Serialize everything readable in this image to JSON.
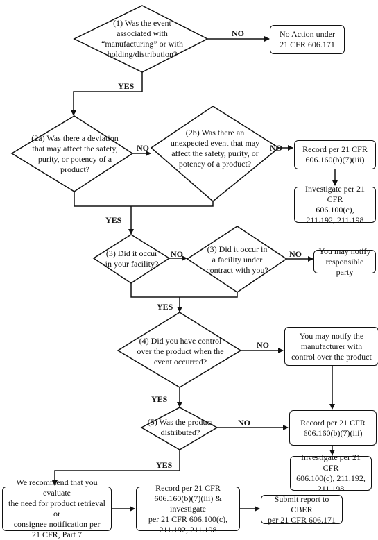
{
  "decisions": {
    "d1": "(1) Was the event\nassociated with\n“manufacturing” or with\nholding/distribution?",
    "d2a": "(2a) Was there a deviation\nthat may affect the safety,\npurity, or potency of a\nproduct?",
    "d2b": "(2b) Was there an\nunexpected event that may\naffect the safety, purity, or\npotency of a product?",
    "d3a": "(3) Did it occur\nin your facility?",
    "d3b": "(3) Did it occur in\na facility under\ncontract with you?",
    "d4": "(4) Did you have control\nover the product when the\nevent occurred?",
    "d5": "(5) Was the product\ndistributed?"
  },
  "boxes": {
    "no_action": "No Action under\n21 CFR 606.171",
    "record_1": "Record per 21 CFR\n606.160(b)(7)(iii)",
    "investigate_1": "Investigate per 21 CFR\n606.100(c),\n211.192, 211.198",
    "notify_responsible": "You may notify\nresponsible party",
    "notify_manufacturer": "You may notify the\nmanufacturer with\ncontrol over the product",
    "record_2": "Record per 21 CFR\n606.160(b)(7)(iii)",
    "investigate_2": "Investigate per 21 CFR\n606.100(c), 211.192,\n211.198",
    "recommend": "We recommend that you evaluate\nthe need for product retrieval or\nconsignee notification per\n21 CFR, Part 7",
    "record_investigate": "Record per 21 CFR\n606.160(b)(7)(iii) & investigate\nper 21 CFR 606.100(c),\n211.192, 211.198",
    "submit": "Submit report to CBER\nper 21 CFR 606.171"
  },
  "labels": {
    "yes": "YES",
    "no": "NO"
  }
}
